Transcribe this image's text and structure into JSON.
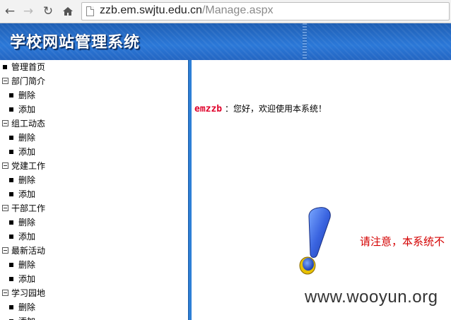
{
  "browser": {
    "back_icon": "arrow-left-icon",
    "forward_icon": "arrow-right-icon",
    "reload_icon": "reload-icon",
    "home_icon": "home-icon",
    "url_host": "zzb.em.swjtu.edu.cn",
    "url_path": "/Manage.aspx"
  },
  "site": {
    "title": "学校网站管理系统"
  },
  "sidebar": {
    "home": "管理首页",
    "groups": [
      {
        "label": "部门简介",
        "items": [
          "删除",
          "添加"
        ]
      },
      {
        "label": "组工动态",
        "items": [
          "删除",
          "添加"
        ]
      },
      {
        "label": "党建工作",
        "items": [
          "删除",
          "添加"
        ]
      },
      {
        "label": "干部工作",
        "items": [
          "删除",
          "添加"
        ]
      },
      {
        "label": "最新活动",
        "items": [
          "删除",
          "添加"
        ]
      },
      {
        "label": "学习园地",
        "items": [
          "删除",
          "添加"
        ]
      }
    ]
  },
  "main": {
    "username": "emzzb",
    "welcome_text": " ：您好，欢迎使用本系统！",
    "notice": "请注意，本系统不",
    "watermark": "www.wooyun.org"
  },
  "colors": {
    "banner": "#2b78d8",
    "splitter": "#2d7fd6",
    "username": "#e0002a",
    "notice": "#d40000"
  }
}
